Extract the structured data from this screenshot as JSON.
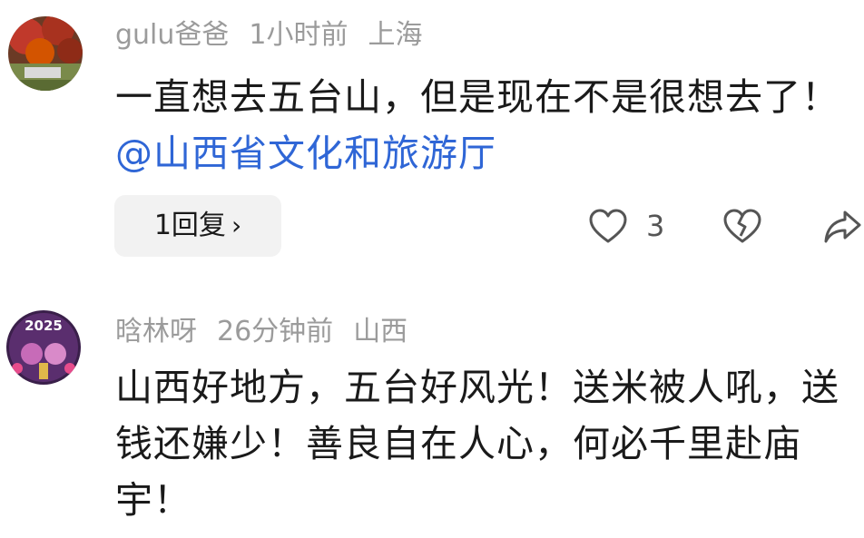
{
  "comments": [
    {
      "username": "gulu爸爸",
      "time": "1小时前",
      "location": "上海",
      "text": "一直想去五台山，但是现在不是很想去了！",
      "mention": "@山西省文化和旅游厅",
      "reply_label": "1回复",
      "like_count": "3",
      "icons": [
        "avatar",
        "heart-icon",
        "broken-heart-icon",
        "share-icon",
        "chevron-right-icon"
      ]
    },
    {
      "username": "晗林呀",
      "time": "26分钟前",
      "location": "山西",
      "text": "山西好地方，五台好风光！送米被人吼，送钱还嫌少！善良自在人心，何必千里赴庙宇！",
      "avatar_text": "2025"
    }
  ]
}
